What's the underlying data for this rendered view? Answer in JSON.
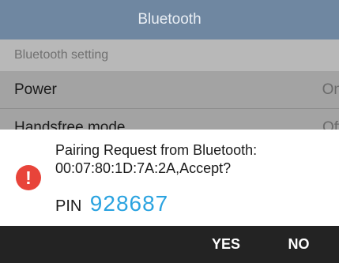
{
  "header": {
    "title": "Bluetooth"
  },
  "settings": {
    "section_title": "Bluetooth setting",
    "rows": [
      {
        "label": "Power",
        "value": "On"
      },
      {
        "label": "Handsfree mode",
        "value": "Off"
      }
    ]
  },
  "dialog": {
    "message_line1": "Pairing Request from Bluetooth:",
    "message_line2": "00:07:80:1D:7A:2A,Accept?",
    "pin_label": "PIN",
    "pin_value": "928687",
    "icon": "exclamation-icon",
    "accent_color": "#2aa3e0",
    "icon_color": "#e8443a",
    "buttons": {
      "yes": "YES",
      "no": "NO"
    }
  }
}
